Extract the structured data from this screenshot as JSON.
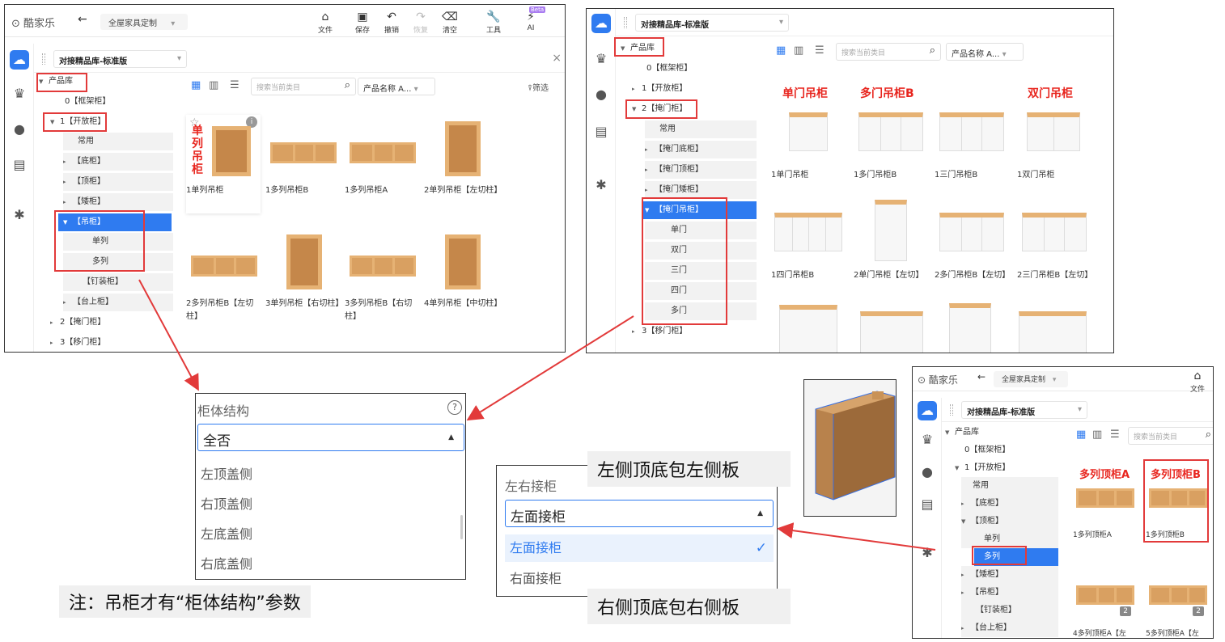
{
  "app": {
    "logo": "酷家乐",
    "project": "全屋家具定制",
    "toolbar": {
      "file": "文件",
      "save": "保存",
      "undo": "撤销",
      "redo": "恢复",
      "clear": "清空",
      "tools": "工具",
      "ai": "AI",
      "beta": "Beta"
    }
  },
  "library": {
    "name": "对接精品库-标准版"
  },
  "panel1": {
    "tree": [
      "产品库",
      "0【框架柜】",
      "1【开放柜】",
      "常用",
      "【底柜】",
      "【顶柜】",
      "【矮柜】",
      "【吊柜】",
      "单列",
      "多列",
      "【钉装柜】",
      "【台上柜】",
      "2【掩门柜】",
      "3【移门柜】"
    ],
    "search_placeholder": "搜索当前类目",
    "sort": "产品名称 A...",
    "filter": "筛选",
    "products": [
      "1单列吊柜",
      "1多列吊柜B",
      "1多列吊柜A",
      "2单列吊柜【左切柱】",
      "2多列吊柜B【左切柱】",
      "3单列吊柜【右切柱】",
      "3多列吊柜B【右切柱】",
      "4单列吊柜【中切柱】"
    ],
    "annotation": "单列吊柜"
  },
  "panel2": {
    "tree": [
      "产品库",
      "0【框架柜】",
      "1【开放柜】",
      "2【掩门柜】",
      "常用",
      "【掩门底柜】",
      "【掩门顶柜】",
      "【掩门矮柜】",
      "【掩门吊柜】",
      "单门",
      "双门",
      "三门",
      "四门",
      "多门",
      "3【移门柜】"
    ],
    "search_placeholder": "搜索当前类目",
    "sort": "产品名称 A...",
    "labels": [
      "单门吊柜",
      "多门吊柜B",
      "双门吊柜"
    ],
    "products": [
      "1单门吊柜",
      "1多门吊柜B",
      "1三门吊柜B",
      "1双门吊柜",
      "1四门吊柜B",
      "2单门吊柜【左切】",
      "2多门吊柜B【左切】",
      "2三门吊柜B【左切】"
    ]
  },
  "panel3": {
    "tree": [
      "产品库",
      "0【框架柜】",
      "1【开放柜】",
      "常用",
      "【底柜】",
      "【顶柜】",
      "单列",
      "多列",
      "【矮柜】",
      "【吊柜】",
      "【钉装柜】",
      "【台上柜】"
    ],
    "search_placeholder": "搜索当前类目",
    "labels": [
      "多列顶柜A",
      "多列顶柜B"
    ],
    "products": [
      "1多列顶柜A",
      "1多列顶柜B",
      "4多列顶柜A【左",
      "5多列顶柜A【左"
    ],
    "badges": [
      "2",
      "2"
    ]
  },
  "dropdown1": {
    "label": "柜体结构",
    "value": "全否",
    "options": [
      "左顶盖侧",
      "右顶盖侧",
      "左底盖侧",
      "右底盖侧"
    ],
    "help": "?"
  },
  "dropdown2": {
    "label": "左右接柜",
    "value": "左面接柜",
    "options": [
      "左面接柜",
      "右面接柜"
    ]
  },
  "notes": {
    "main": "注：吊柜才有“柜体结构”参数",
    "left_side": "左侧顶底包左侧板",
    "right_side": "右侧顶底包右侧板"
  },
  "colors": {
    "accent": "#2f7bf0",
    "annotation": "#e23a3a",
    "wood": "#e6b274"
  }
}
